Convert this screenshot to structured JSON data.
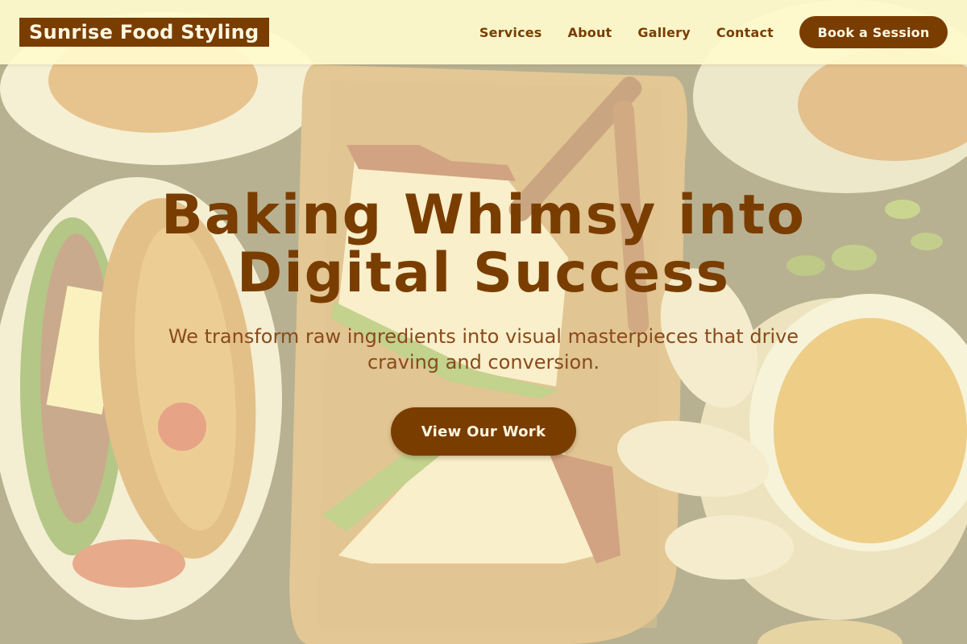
{
  "header": {
    "brand": "Sunrise Food Styling",
    "nav": [
      "Services",
      "About",
      "Gallery",
      "Contact"
    ],
    "cta_label": "Book a Session"
  },
  "hero": {
    "title_line1": "Baking Whimsy into",
    "title_line2": "Digital Success",
    "subtitle_line1": "We transform raw ingredients into visual masterpieces that drive",
    "subtitle_line2": "craving and conversion.",
    "button_label": "View Our Work"
  },
  "colors": {
    "accent": "#7a3d00",
    "header_bg": "#fffacd",
    "button_text": "#fff8e1"
  },
  "background_image": "food-flat-lay-photo"
}
